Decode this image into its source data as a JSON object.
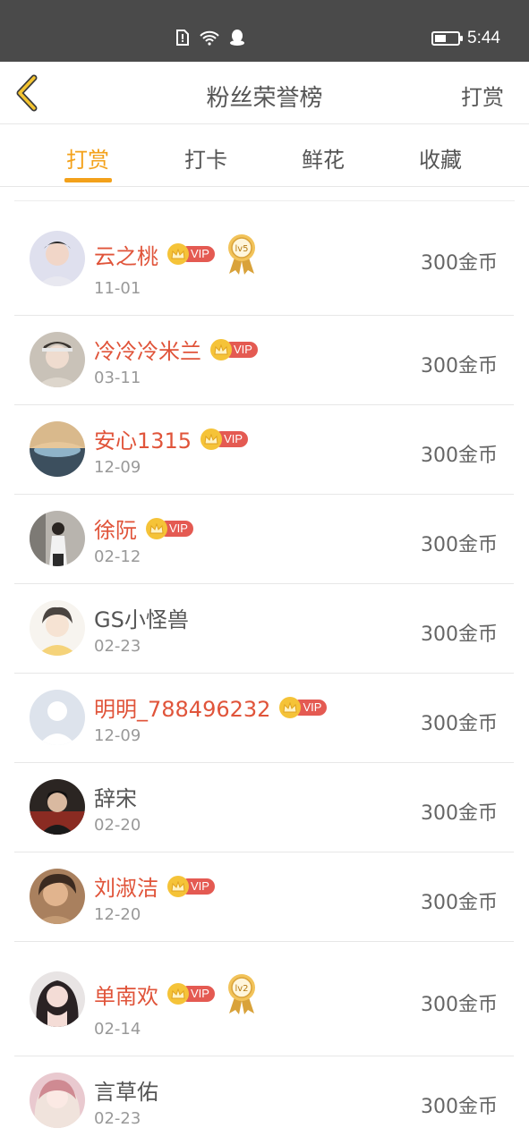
{
  "status": {
    "time": "5:44"
  },
  "header": {
    "title": "粉丝荣誉榜",
    "action": "打赏"
  },
  "tabs": [
    {
      "label": "打赏"
    },
    {
      "label": "打卡"
    },
    {
      "label": "鲜花"
    },
    {
      "label": "收藏"
    }
  ],
  "badges": {
    "vip": "VIP"
  },
  "rows": [
    {
      "name": "云之桃",
      "date": "11-01",
      "amount": "300金币",
      "medal": "lv5"
    },
    {
      "name": "冷冷冷米兰",
      "date": "03-11",
      "amount": "300金币"
    },
    {
      "name": "安心1315",
      "date": "12-09",
      "amount": "300金币"
    },
    {
      "name": "徐阮",
      "date": "02-12",
      "amount": "300金币"
    },
    {
      "name": "GS小怪兽",
      "date": "02-23",
      "amount": "300金币"
    },
    {
      "name": "明明_788496232",
      "date": "12-09",
      "amount": "300金币"
    },
    {
      "name": "辞宋",
      "date": "02-20",
      "amount": "300金币"
    },
    {
      "name": "刘淑洁",
      "date": "12-20",
      "amount": "300金币"
    },
    {
      "name": "单南欢",
      "date": "02-14",
      "amount": "300金币",
      "medal": "lv2"
    },
    {
      "name": "言草佑",
      "date": "02-23",
      "amount": "300金币"
    }
  ],
  "colors": {
    "accent": "#f3a11a",
    "vip_name": "#e0543a",
    "status_bar": "#4a4a4a"
  }
}
